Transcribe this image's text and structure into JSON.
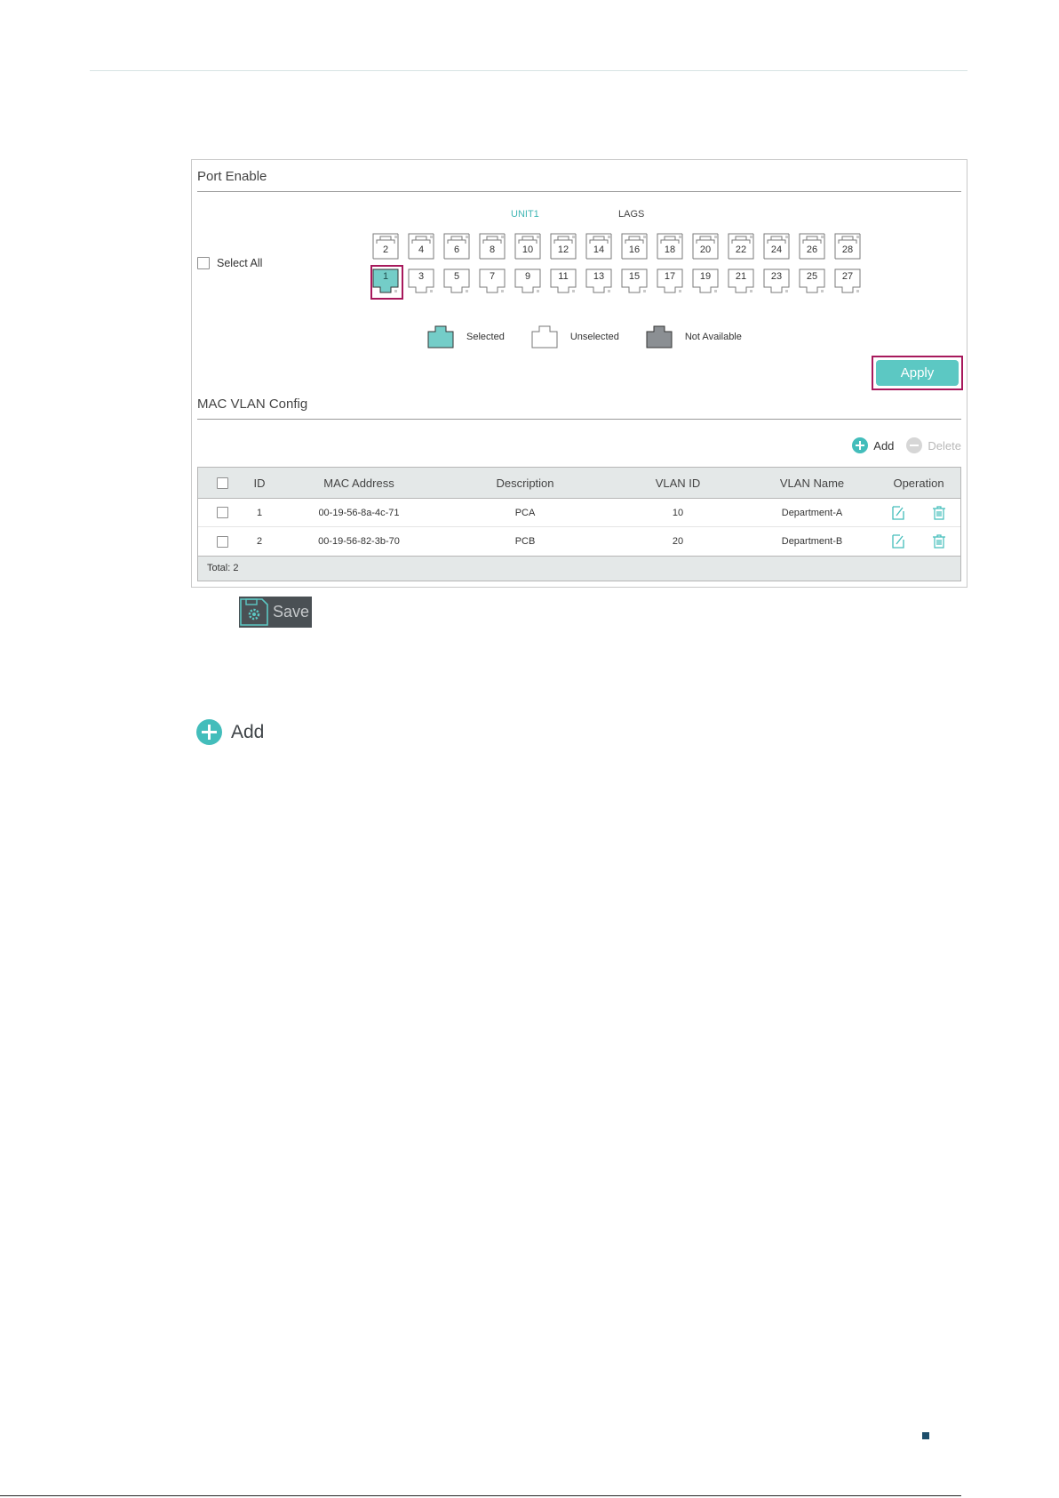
{
  "port_enable": {
    "title": "Port Enable",
    "select_all_label": "Select All",
    "tabs": [
      "UNIT1",
      "LAGS"
    ],
    "ports_top": [
      "2",
      "4",
      "6",
      "8",
      "10",
      "12",
      "14",
      "16",
      "18",
      "20",
      "22",
      "24",
      "26",
      "28"
    ],
    "ports_bottom": [
      "1",
      "3",
      "5",
      "7",
      "9",
      "11",
      "13",
      "15",
      "17",
      "19",
      "21",
      "23",
      "25",
      "27"
    ],
    "selected_ports": [
      "1"
    ],
    "legend": {
      "selected": "Selected",
      "unselected": "Unselected",
      "not_available": "Not Available"
    },
    "apply_label": "Apply"
  },
  "mac_vlan": {
    "title": "MAC VLAN Config",
    "add_label": "Add",
    "delete_label": "Delete",
    "columns": [
      "ID",
      "MAC Address",
      "Description",
      "VLAN ID",
      "VLAN Name",
      "Operation"
    ],
    "rows": [
      {
        "id": "1",
        "mac": "00-19-56-8a-4c-71",
        "description": "PCA",
        "vlan_id": "10",
        "vlan_name": "Department-A"
      },
      {
        "id": "2",
        "mac": "00-19-56-82-3b-70",
        "description": "PCB",
        "vlan_id": "20",
        "vlan_name": "Department-B"
      }
    ],
    "total": "Total: 2"
  },
  "save_label": "Save",
  "add_button_label": "Add",
  "icons": {
    "add": "plus-circle-icon",
    "delete": "minus-circle-icon",
    "edit": "edit-icon",
    "trash": "trash-icon",
    "save": "save-gear-icon"
  },
  "colors": {
    "accent": "#43bdbb",
    "highlight": "#a7195c",
    "save_bg": "#4a5054"
  }
}
